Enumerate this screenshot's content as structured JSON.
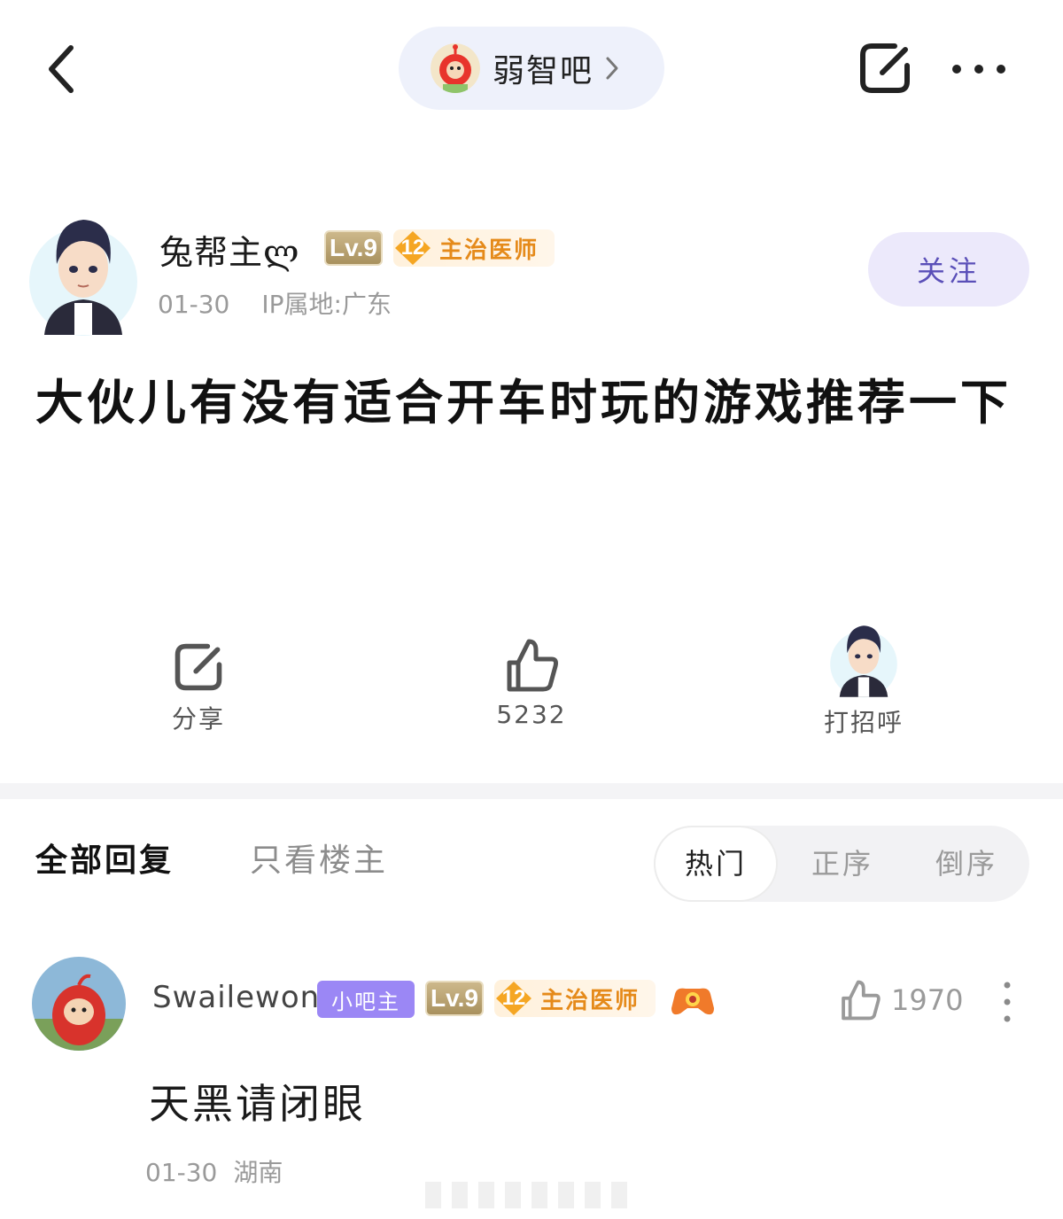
{
  "header": {
    "forum_name": "弱智吧"
  },
  "author": {
    "name": "兔帮主ლ",
    "level": "Lv.9",
    "rank_num": "12",
    "rank_title": "主治医师",
    "date": "01-30",
    "ip": "IP属地:广东",
    "follow_label": "关注"
  },
  "post": {
    "title": "大伙儿有没有适合开车时玩的游戏推荐一下"
  },
  "actions": {
    "share_label": "分享",
    "like_count": "5232",
    "greet_label": "打招呼"
  },
  "reply_tabs": {
    "all": "全部回复",
    "op_only": "只看楼主"
  },
  "sort": {
    "hot": "热门",
    "asc": "正序",
    "desc": "倒序"
  },
  "comment": {
    "username": "Swailewon",
    "admin_badge": "小吧主",
    "level": "Lv.9",
    "rank_num": "12",
    "rank_title": "主治医师",
    "likes": "1970",
    "text": "天黑请闭眼",
    "date": "01-30",
    "location": "湖南"
  },
  "colors": {
    "follow_bg": "#ece9fb",
    "follow_text": "#5a4fb8",
    "admin_badge": "#9b87f5",
    "rank_text": "#e58a1a"
  }
}
